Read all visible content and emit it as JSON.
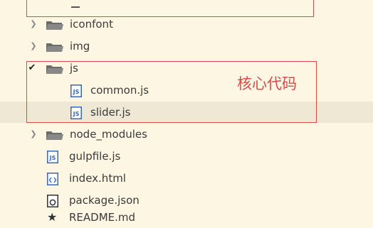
{
  "tree": {
    "items": [
      {
        "name": "iconfont",
        "type": "folder",
        "expanded": false
      },
      {
        "name": "img",
        "type": "folder",
        "expanded": false
      },
      {
        "name": "js",
        "type": "folder",
        "expanded": true
      },
      {
        "name": "common.js",
        "type": "js-file"
      },
      {
        "name": "slider.js",
        "type": "js-file",
        "selected": true
      },
      {
        "name": "node_modules",
        "type": "folder",
        "expanded": false
      },
      {
        "name": "gulpfile.js",
        "type": "js-file"
      },
      {
        "name": "index.html",
        "type": "html-file"
      },
      {
        "name": "package.json",
        "type": "json-file"
      },
      {
        "name": "README.md",
        "type": "markdown-file"
      }
    ]
  },
  "annotation": {
    "label": "核心代码",
    "color": "#d64b4b"
  },
  "colors": {
    "background": "#fdf6e3",
    "selected_row": "#eee8d5",
    "js_icon": "#3b67b8"
  }
}
